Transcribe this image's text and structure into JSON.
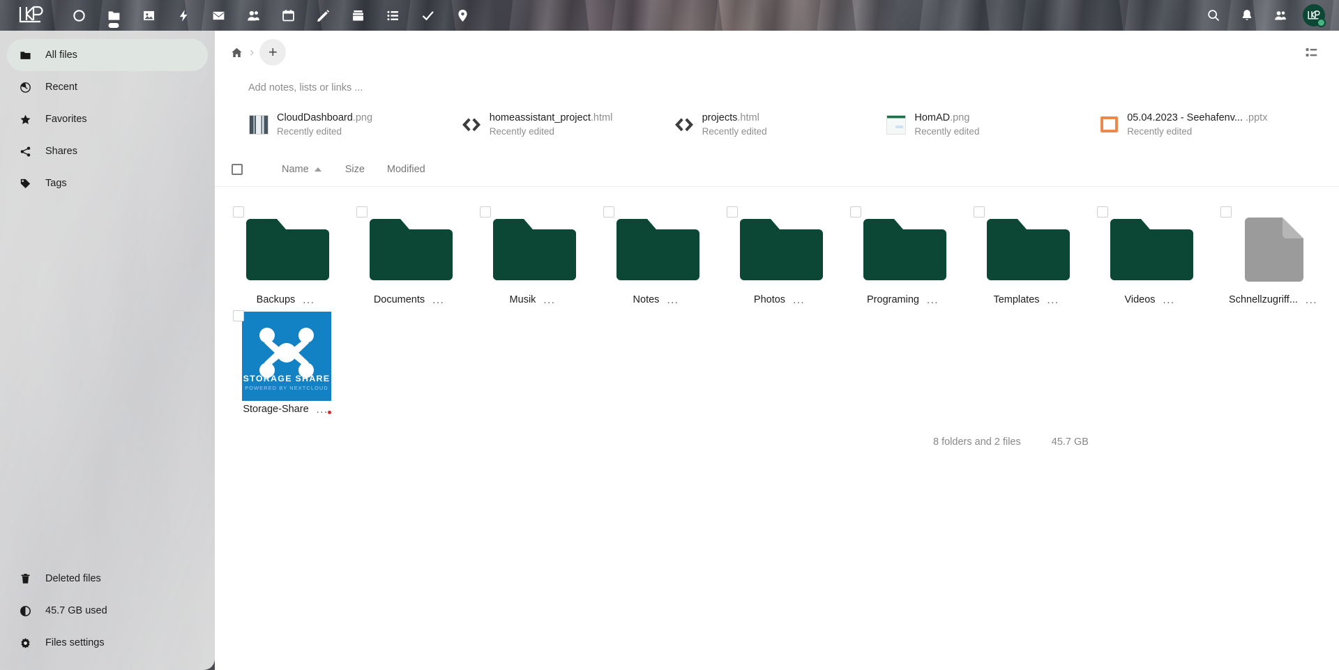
{
  "theme": {
    "folder_color": "#0b4734",
    "file_color": "#9b9b9b",
    "accent_orange": "#eb8a4e",
    "logo_blue": "#1282c5",
    "status_green": "#49b382"
  },
  "topbar": {
    "logo_name": "kp-logo",
    "apps": [
      {
        "name": "dashboard-icon",
        "label": "Dashboard",
        "active": false
      },
      {
        "name": "files-icon",
        "label": "Files",
        "active": true
      },
      {
        "name": "photos-icon",
        "label": "Photos",
        "active": false
      },
      {
        "name": "activity-icon",
        "label": "Activity",
        "active": false
      },
      {
        "name": "mail-icon",
        "label": "Mail",
        "active": false
      },
      {
        "name": "contacts-icon",
        "label": "Contacts",
        "active": false
      },
      {
        "name": "calendar-icon",
        "label": "Calendar",
        "active": false
      },
      {
        "name": "notes-icon",
        "label": "Notes",
        "active": false
      },
      {
        "name": "deck-icon",
        "label": "Deck",
        "active": false
      },
      {
        "name": "tasks-icon",
        "label": "Tasks",
        "active": false
      },
      {
        "name": "checkmark-icon",
        "label": "Checks",
        "active": false
      },
      {
        "name": "maps-icon",
        "label": "Maps",
        "active": false
      }
    ],
    "right": [
      {
        "name": "search-icon",
        "label": "Search"
      },
      {
        "name": "notifications-icon",
        "label": "Notifications"
      },
      {
        "name": "contacts-menu-icon",
        "label": "Contacts"
      }
    ],
    "avatar_label": "KP",
    "status": "online"
  },
  "sidebar": {
    "items": [
      {
        "icon": "folder-icon",
        "label": "All files",
        "active": true
      },
      {
        "icon": "clock-icon",
        "label": "Recent",
        "active": false
      },
      {
        "icon": "star-icon",
        "label": "Favorites",
        "active": false
      },
      {
        "icon": "share-icon",
        "label": "Shares",
        "active": false
      },
      {
        "icon": "tag-icon",
        "label": "Tags",
        "active": false
      }
    ],
    "bottom": [
      {
        "icon": "trash-icon",
        "label": "Deleted files"
      },
      {
        "icon": "quota-icon",
        "label": "45.7 GB used"
      },
      {
        "icon": "gear-icon",
        "label": "Files settings"
      }
    ]
  },
  "breadcrumb": {
    "home_icon": "home-icon",
    "separator": "›",
    "add_label": "+",
    "view_toggle_icon": "list-view-icon"
  },
  "notes": {
    "placeholder": "Add notes, lists or links ..."
  },
  "recent": {
    "subtitle": "Recently edited",
    "items": [
      {
        "basename": "CloudDashboard",
        "ext": ".png",
        "icon": "image-thumb",
        "sub": "Recently edited"
      },
      {
        "basename": "homeassistant_project",
        "ext": ".html",
        "icon": "code-icon",
        "sub": "Recently edited"
      },
      {
        "basename": "projects",
        "ext": ".html",
        "icon": "code-icon",
        "sub": "Recently edited"
      },
      {
        "basename": "HomAD",
        "ext": ".png",
        "icon": "image-thumb-2",
        "sub": "Recently edited"
      },
      {
        "basename": "05.04.2023 - Seehafenv...",
        "ext": " .pptx",
        "icon": "powerpoint-icon",
        "sub": "Recently edited"
      }
    ]
  },
  "table": {
    "columns": [
      {
        "key": "name",
        "label": "Name",
        "sorted": true,
        "direction": "asc"
      },
      {
        "key": "size",
        "label": "Size",
        "sorted": false,
        "direction": ""
      },
      {
        "key": "modified",
        "label": "Modified",
        "sorted": false,
        "direction": ""
      }
    ]
  },
  "files": [
    {
      "name": "Backups",
      "type": "folder",
      "menu": "...",
      "badge": false
    },
    {
      "name": "Documents",
      "type": "folder",
      "menu": "...",
      "badge": false
    },
    {
      "name": "Musik",
      "type": "folder",
      "menu": "...",
      "badge": false
    },
    {
      "name": "Notes",
      "type": "folder",
      "menu": "...",
      "badge": false
    },
    {
      "name": "Photos",
      "type": "folder",
      "menu": "...",
      "badge": false
    },
    {
      "name": "Programing",
      "type": "folder",
      "menu": "...",
      "badge": false
    },
    {
      "name": "Templates",
      "type": "folder",
      "menu": "...",
      "badge": false
    },
    {
      "name": "Videos",
      "type": "folder",
      "menu": "...",
      "badge": false
    },
    {
      "name": "Schnellzugriff...",
      "type": "file",
      "menu": "...",
      "badge": false
    },
    {
      "name": "Storage-Share",
      "type": "logo",
      "menu": "...",
      "badge": true
    }
  ],
  "logo_tile": {
    "title": "STORAGE SHARE",
    "subtitle": "POWERED BY NEXTCLOUD"
  },
  "summary": {
    "count": "8 folders and 2 files",
    "size": "45.7 GB"
  }
}
